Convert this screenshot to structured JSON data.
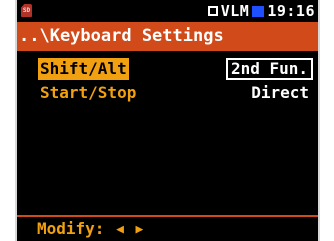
{
  "status": {
    "sd_icon": "sd-card-icon",
    "mode_icon": "square-mode-icon",
    "mode_text": "VLM",
    "battery_icon": "battery-icon",
    "time": "19:16"
  },
  "title": "..\\Keyboard Settings",
  "settings": [
    {
      "label": "Shift/Alt",
      "value": "2nd Fun.",
      "selected": true
    },
    {
      "label": "Start/Stop",
      "value": "Direct",
      "selected": false
    }
  ],
  "footer": {
    "label": "Modify:",
    "left_arrow": "◀",
    "right_arrow": "▶"
  },
  "colors": {
    "accent": "#d04a1a",
    "highlight": "#f0a010",
    "battery": "#1e50ff",
    "background": "#000000"
  }
}
